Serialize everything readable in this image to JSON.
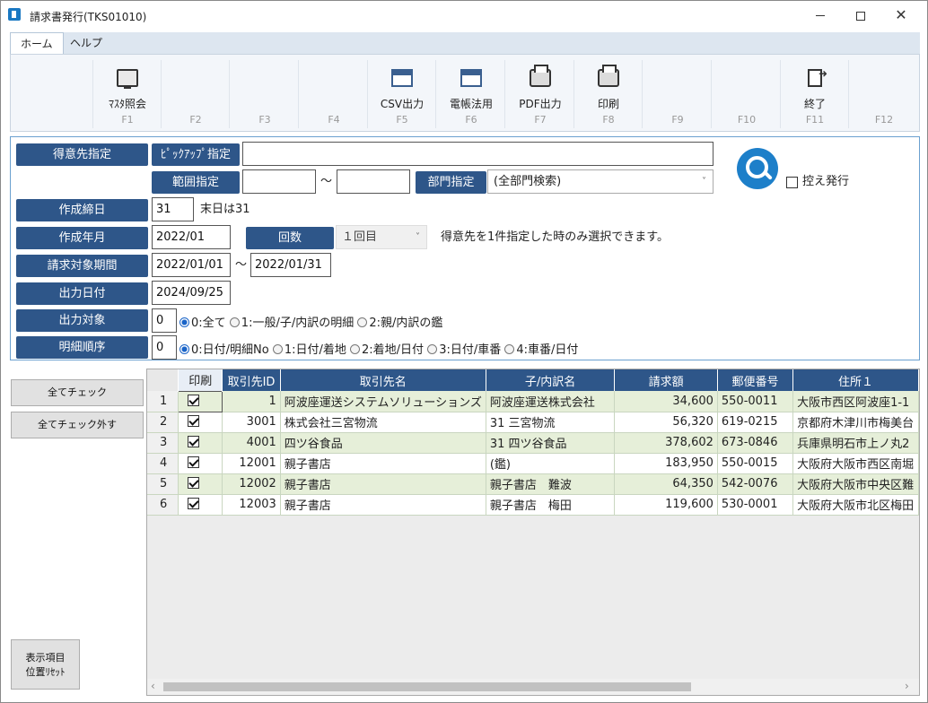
{
  "window": {
    "title": "請求書発行(TKS01010)"
  },
  "ribbon": {
    "tabs": [
      "ホーム",
      "ヘルプ"
    ],
    "buttons": [
      {
        "label": "",
        "key": "",
        "icon": "none"
      },
      {
        "label": "ﾏｽﾀ照会",
        "key": "F1",
        "icon": "monitor-icon"
      },
      {
        "label": "",
        "key": "F2",
        "icon": "none"
      },
      {
        "label": "",
        "key": "F3",
        "icon": "none"
      },
      {
        "label": "",
        "key": "F4",
        "icon": "none"
      },
      {
        "label": "CSV出力",
        "key": "F5",
        "icon": "csv-window-icon"
      },
      {
        "label": "電帳法用",
        "key": "F6",
        "icon": "ledger-window-icon"
      },
      {
        "label": "PDF出力",
        "key": "F7",
        "icon": "pdf-printer-icon"
      },
      {
        "label": "印刷",
        "key": "F8",
        "icon": "printer-icon"
      },
      {
        "label": "",
        "key": "F9",
        "icon": "none"
      },
      {
        "label": "",
        "key": "F10",
        "icon": "none"
      },
      {
        "label": "終了",
        "key": "F11",
        "icon": "exit-door-icon"
      },
      {
        "label": "",
        "key": "F12",
        "icon": "none"
      }
    ]
  },
  "form": {
    "customer_label": "得意先指定",
    "pickup_label": "ﾋﾟｯｸｱｯﾌﾟ指定",
    "pickup_value": "",
    "range_label": "範囲指定",
    "range_from": "",
    "range_tilde": "～",
    "range_to": "",
    "dept_label": "部門指定",
    "dept_value": "(全部門検索)",
    "copy_issue_label": "控え発行",
    "closing_label": "作成締日",
    "closing_value": "31",
    "closing_note": "末日は31",
    "ym_label": "作成年月",
    "ym_value": "2022/01",
    "count_label": "回数",
    "count_value": "１回目",
    "count_note": "得意先を1件指定した時のみ選択できます。",
    "period_label": "請求対象期間",
    "period_from": "2022/01/01",
    "period_tilde": "～",
    "period_to": "2022/01/31",
    "output_date_label": "出力日付",
    "output_date_value": "2024/09/25",
    "target_label": "出力対象",
    "target_value": "0",
    "target_options": [
      "0:全て",
      "1:一般/子/内訳の明細",
      "2:親/内訳の鑑"
    ],
    "order_label": "明細順序",
    "order_value": "0",
    "order_options": [
      "0:日付/明細No",
      "1:日付/着地",
      "2:着地/日付",
      "3:日付/車番",
      "4:車番/日付"
    ]
  },
  "side_buttons": {
    "check_all": "全てチェック",
    "uncheck_all": "全てチェック外す",
    "reset_line1": "表示項目",
    "reset_line2": "位置ﾘｾｯﾄ"
  },
  "grid": {
    "columns": [
      "印刷",
      "取引先ID",
      "取引先名",
      "子/内訳名",
      "請求額",
      "郵便番号",
      "住所１"
    ],
    "rows": [
      {
        "no": "1",
        "checked": true,
        "id": "1",
        "name": "阿波座運送システムソリューションズ",
        "sub": "阿波座運送株式会社",
        "amount": "34,600",
        "zip": "550-0011",
        "addr": "大阪市西区阿波座1-1"
      },
      {
        "no": "2",
        "checked": true,
        "id": "3001",
        "name": "株式会社三宮物流",
        "sub": "31 三宮物流",
        "amount": "56,320",
        "zip": "619-0215",
        "addr": "京都府木津川市梅美台"
      },
      {
        "no": "3",
        "checked": true,
        "id": "4001",
        "name": "四ツ谷食品",
        "sub": "31 四ツ谷食品",
        "amount": "378,602",
        "zip": "673-0846",
        "addr": "兵庫県明石市上ノ丸2"
      },
      {
        "no": "4",
        "checked": true,
        "id": "12001",
        "name": "親子書店",
        "sub": "(鑑)",
        "amount": "183,950",
        "zip": "550-0015",
        "addr": "大阪府大阪市西区南堀"
      },
      {
        "no": "5",
        "checked": true,
        "id": "12002",
        "name": "親子書店",
        "sub": "親子書店　難波",
        "amount": "64,350",
        "zip": "542-0076",
        "addr": "大阪府大阪市中央区難"
      },
      {
        "no": "6",
        "checked": true,
        "id": "12003",
        "name": "親子書店",
        "sub": "親子書店　梅田",
        "amount": "119,600",
        "zip": "530-0001",
        "addr": "大阪府大阪市北区梅田"
      }
    ]
  }
}
